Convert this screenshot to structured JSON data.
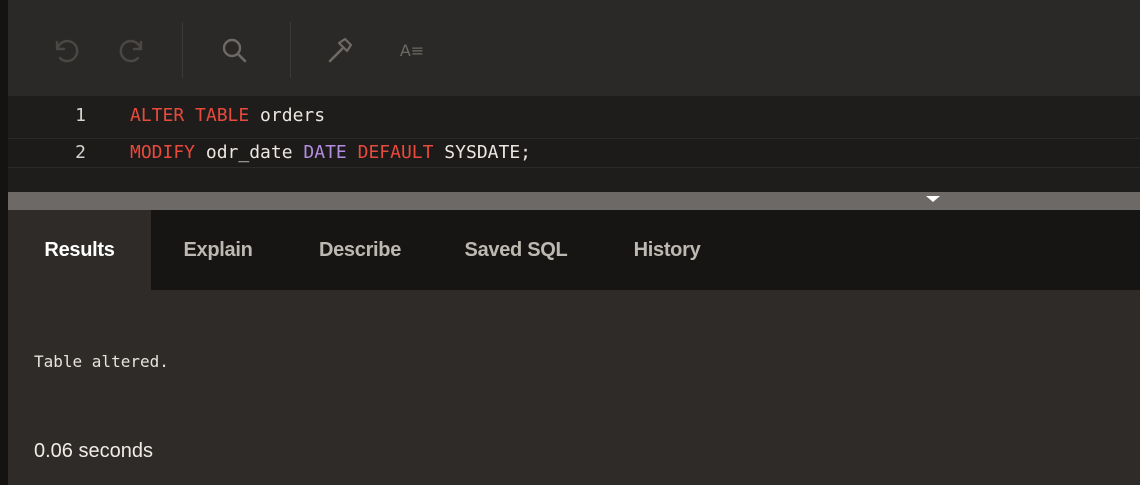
{
  "toolbar": {
    "buttons": [
      {
        "name": "undo-icon"
      },
      {
        "name": "redo-icon"
      },
      {
        "name": "search-icon"
      },
      {
        "name": "hammer-icon"
      },
      {
        "name": "sort-az-icon",
        "glyph": "A≡"
      }
    ]
  },
  "editor": {
    "lines": [
      {
        "number": "1",
        "tokens": [
          {
            "text": "ALTER",
            "kind": "keyword"
          },
          {
            "text": " ",
            "kind": "space"
          },
          {
            "text": "TABLE",
            "kind": "keyword"
          },
          {
            "text": " orders",
            "kind": "identifier"
          }
        ]
      },
      {
        "number": "2",
        "tokens": [
          {
            "text": "MODIFY",
            "kind": "keyword"
          },
          {
            "text": " odr_date ",
            "kind": "identifier"
          },
          {
            "text": "DATE",
            "kind": "type"
          },
          {
            "text": " ",
            "kind": "space"
          },
          {
            "text": "DEFAULT",
            "kind": "keyword"
          },
          {
            "text": " SYSDATE;",
            "kind": "identifier"
          }
        ]
      }
    ]
  },
  "tabs": [
    {
      "label": "Results",
      "active": true
    },
    {
      "label": "Explain",
      "active": false
    },
    {
      "label": "Describe",
      "active": false
    },
    {
      "label": "Saved SQL",
      "active": false
    },
    {
      "label": "History",
      "active": false
    }
  ],
  "results": {
    "message": "Table altered.",
    "elapsed": "0.06 seconds"
  },
  "colors": {
    "keyword": "#e84a3c",
    "type": "#b48ce0",
    "identifier": "#ece7df",
    "background": "#2e2b29",
    "editor_bg": "#1f1d1c"
  }
}
